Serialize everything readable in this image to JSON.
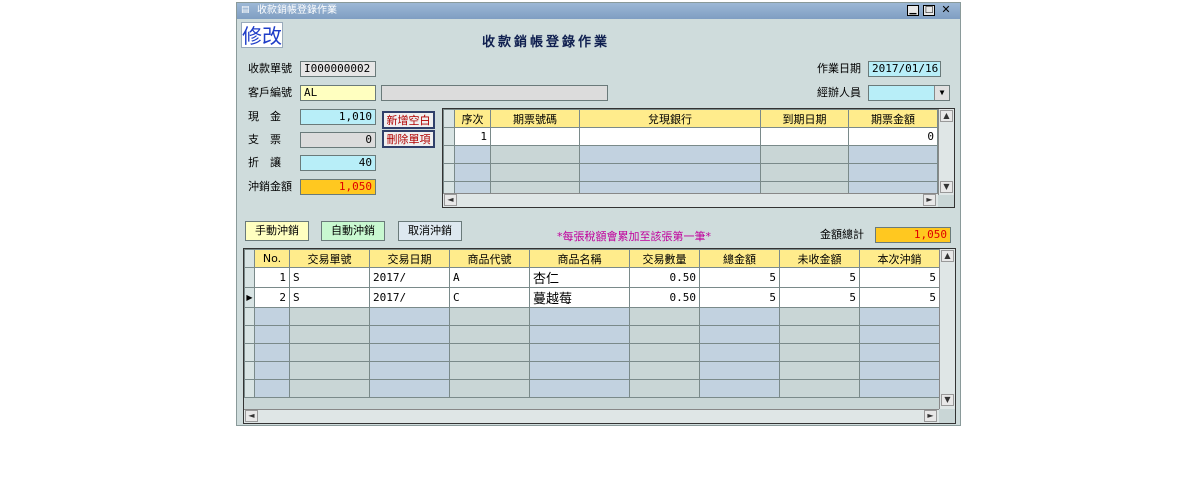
{
  "window": {
    "title": "收款銷帳登錄作業"
  },
  "mode": "修改",
  "form_title": "收款銷帳登錄作業",
  "receipt_no": {
    "label": "收款單號",
    "value": "I000000002"
  },
  "work_date": {
    "label": "作業日期",
    "value": "2017/01/16"
  },
  "customer": {
    "label": "客戶編號",
    "value": "AL",
    "name": ""
  },
  "handler": {
    "label": "經辦人員",
    "value": ""
  },
  "cash": {
    "label": "現　金",
    "value": "1,010"
  },
  "check": {
    "label": "支　票",
    "value": "0"
  },
  "discount": {
    "label": "折　讓",
    "value": "40"
  },
  "offset_total": {
    "label": "沖銷金額",
    "value": "1,050"
  },
  "buttons": {
    "add_blank": "新增空白",
    "delete_item": "刪除單項",
    "manual": "手動沖銷",
    "auto": "自動沖銷",
    "cancel": "取消沖銷"
  },
  "check_grid": {
    "headers": [
      "序次",
      "期票號碼",
      "兌現銀行",
      "到期日期",
      "期票金額"
    ],
    "rows": [
      [
        "1",
        "",
        "",
        "",
        "0"
      ]
    ]
  },
  "notice": "*每張稅額會累加至該張第一筆*",
  "amount_total": {
    "label": "金額總計",
    "value": "1,050"
  },
  "detail_grid": {
    "headers": [
      "No.",
      "交易單號",
      "交易日期",
      "商品代號",
      "商品名稱",
      "交易數量",
      "總金額",
      "未收金額",
      "本次沖銷"
    ],
    "rows": [
      [
        "1",
        "S",
        "2017/",
        "A",
        "杏仁",
        "0.50",
        "5",
        "5",
        "5"
      ],
      [
        "2",
        "S",
        "2017/",
        "C",
        "蔓越莓",
        "0.50",
        "5",
        "5",
        "5"
      ]
    ]
  },
  "colors": {
    "header": "#ffec8c",
    "window_bg": "#cfdcdc",
    "highlight": "#ffc820",
    "title_bar": "#8fadcf"
  }
}
